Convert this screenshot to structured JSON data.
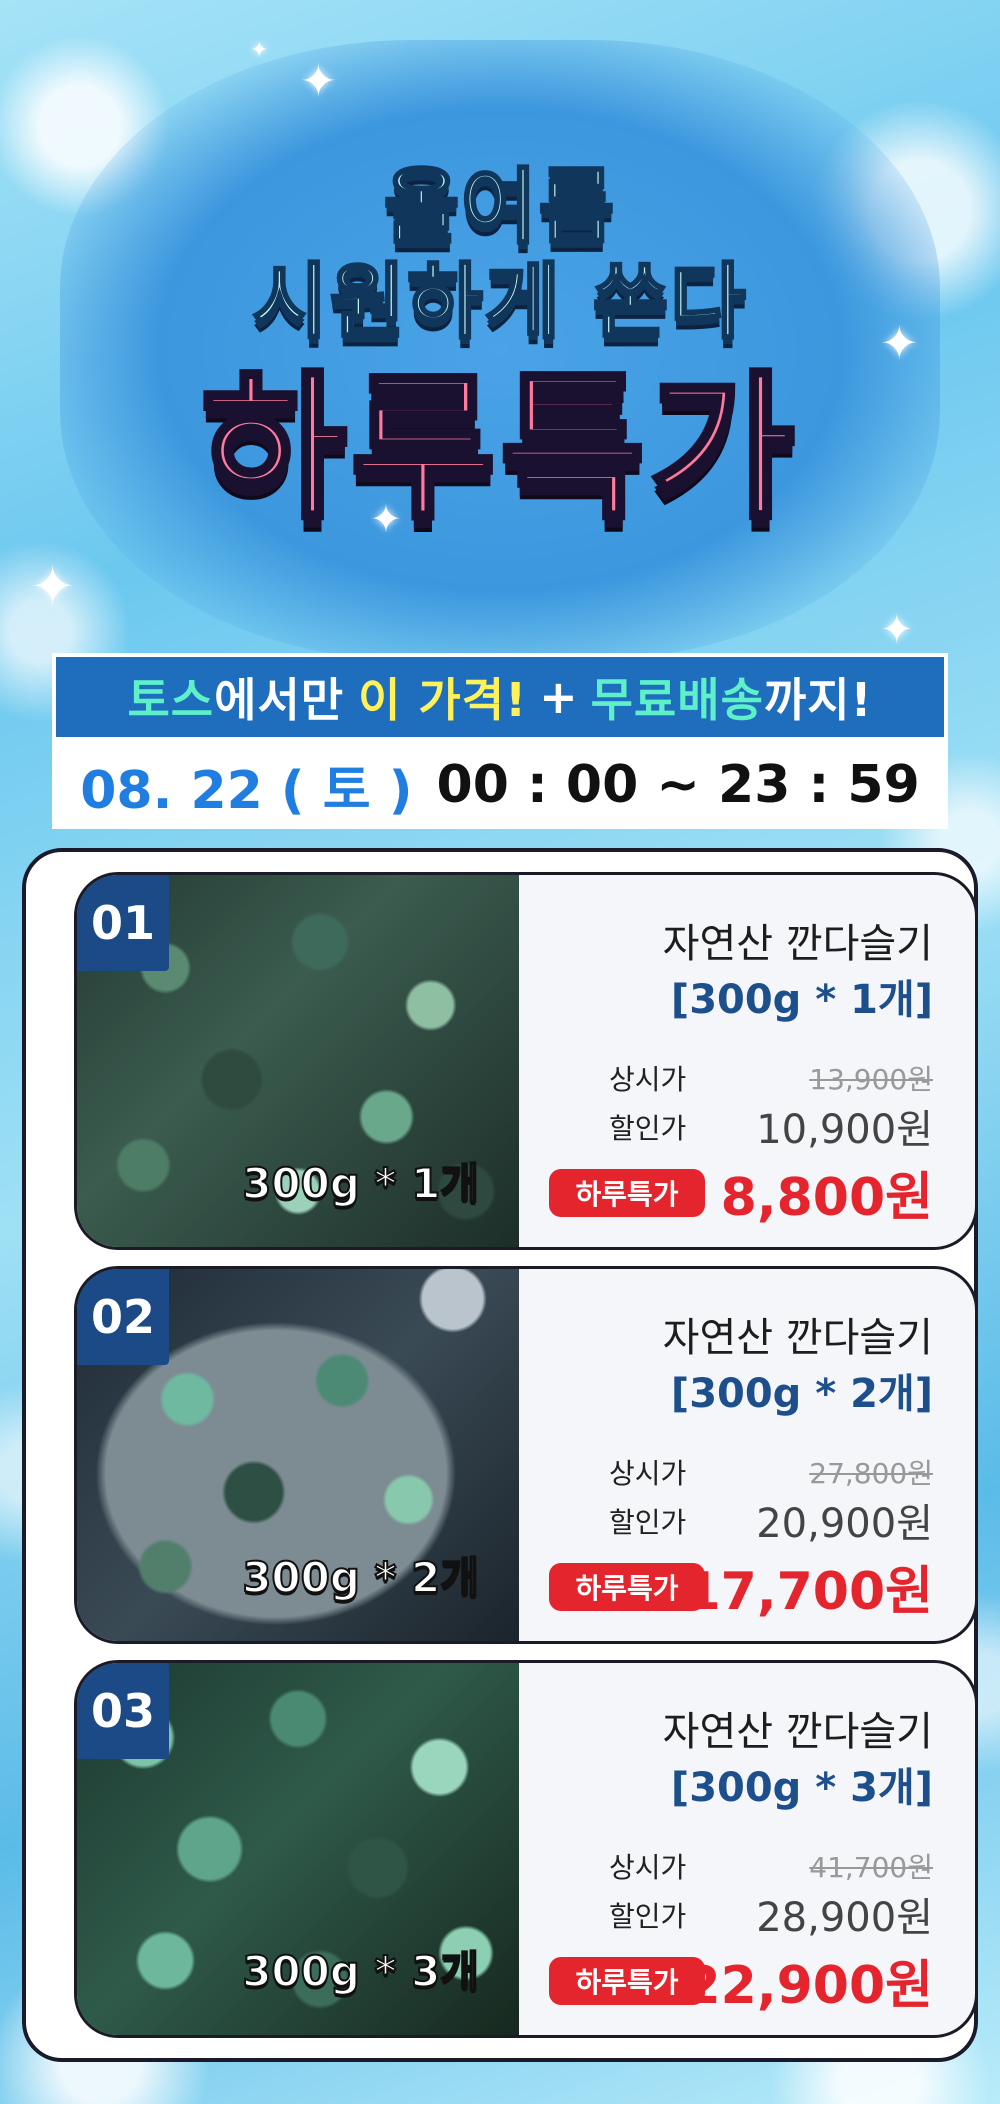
{
  "hero": {
    "line1": "올여름",
    "line2": "시원하게 쏜다",
    "title": "하루특가"
  },
  "banner": {
    "part1": "토스",
    "part2": "에서만",
    "part3": "이 가격!",
    "plus": "+",
    "part4": "무료배송",
    "part5": "까지!"
  },
  "schedule": {
    "date": "08. 22 ( 토 )",
    "time": "00 : 00 ~ 23 : 59"
  },
  "labels": {
    "regular": "상시가",
    "discount": "할인가",
    "special": "하루특가"
  },
  "products": [
    {
      "number": "01",
      "photo_label": "300g * 1개",
      "name": "자연산 깐다슬기",
      "qty": "[300g * 1개]",
      "regular_price": "13,900원",
      "discount_price": "10,900원",
      "special_price": "8,800원"
    },
    {
      "number": "02",
      "photo_label": "300g * 2개",
      "name": "자연산 깐다슬기",
      "qty": "[300g * 2개]",
      "regular_price": "27,800원",
      "discount_price": "20,900원",
      "special_price": "17,700원"
    },
    {
      "number": "03",
      "photo_label": "300g * 3개",
      "name": "자연산 깐다슬기",
      "qty": "[300g * 3개]",
      "regular_price": "41,700원",
      "discount_price": "28,900원",
      "special_price": "22,900원"
    }
  ],
  "colors": {
    "accent_red": "#e5252e",
    "navy": "#1b4a86",
    "banner_blue": "#1f6dbd",
    "date_blue": "#1f7ee0",
    "title_pink": "#ff7a9c"
  }
}
